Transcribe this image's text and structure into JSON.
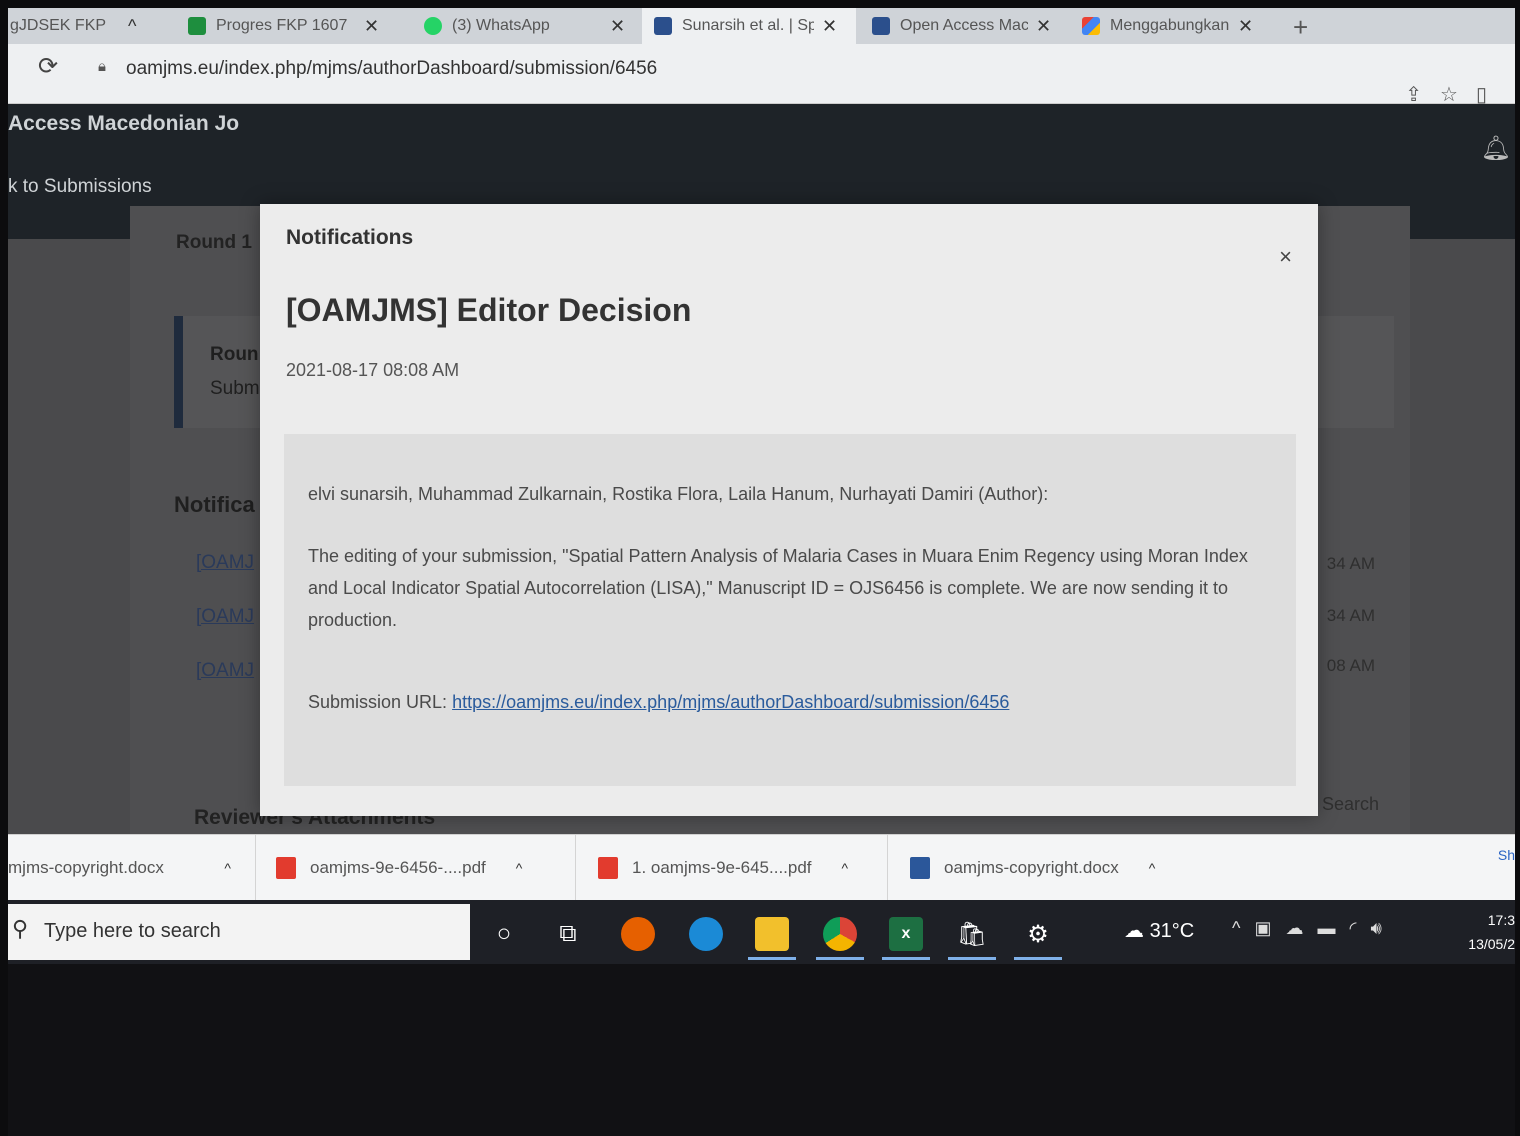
{
  "tabs": [
    {
      "label": "gJDSEK FKP",
      "active": false
    },
    {
      "label": "Progres FKP 1607",
      "active": false
    },
    {
      "label": "(3) WhatsApp",
      "active": false
    },
    {
      "label": "Sunarsih et al. | Sp",
      "active": true
    },
    {
      "label": "Open Access Mac",
      "active": false
    },
    {
      "label": "Menggabungkan F",
      "active": false
    }
  ],
  "browser": {
    "url": "oamjms.eu/index.php/mjms/authorDashboard/submission/6456",
    "new_tab": "+"
  },
  "page": {
    "journal_title": "Access Macedonian Jo",
    "back_link": "k to Submissions",
    "round_label": "Round 1",
    "round_box_title": "Roun",
    "round_box_sub": "Subm",
    "notifications_heading": "Notifica",
    "notification_rows": [
      {
        "label": "[OAMJ",
        "time": "34 AM"
      },
      {
        "label": "[OAMJ",
        "time": "34 AM"
      },
      {
        "label": "[OAMJ",
        "time": "08 AM"
      }
    ],
    "attachments_heading": "Reviewer's Attachments",
    "search_label": "Search"
  },
  "modal": {
    "label": "Notifications",
    "close": "×",
    "title": "[OAMJMS] Editor Decision",
    "date": "2021-08-17 08:08 AM",
    "recipients": "elvi sunarsih, Muhammad Zulkarnain, Rostika Flora, Laila Hanum, Nurhayati Damiri (Author):",
    "message": "The editing of your submission, \"Spatial Pattern Analysis of Malaria Cases in Muara Enim Regency using Moran Index and Local Indicator Spatial Autocorrelation (LISA),\" Manuscript ID = OJS6456 is complete. We are now sending it to production.",
    "submission_url_label": "Submission URL:",
    "submission_url": "https://oamjms.eu/index.php/mjms/authorDashboard/submission/6456"
  },
  "downloads": [
    {
      "name": "mjms-copyright.docx",
      "type": "docx"
    },
    {
      "name": "oamjms-9e-6456-....pdf",
      "type": "pdf"
    },
    {
      "name": "1. oamjms-9e-645....pdf",
      "type": "pdf"
    },
    {
      "name": "oamjms-copyright.docx",
      "type": "docx"
    }
  ],
  "downloads_show_all": "Sh",
  "taskbar": {
    "search_placeholder": "Type here to search",
    "weather": "31°C",
    "time": "17:3",
    "date": "13/05/2"
  },
  "colors": {
    "link": "#2a5b9c",
    "header": "#1e2328",
    "modal_bg": "#ececec",
    "modal_body_bg": "#dedede"
  }
}
